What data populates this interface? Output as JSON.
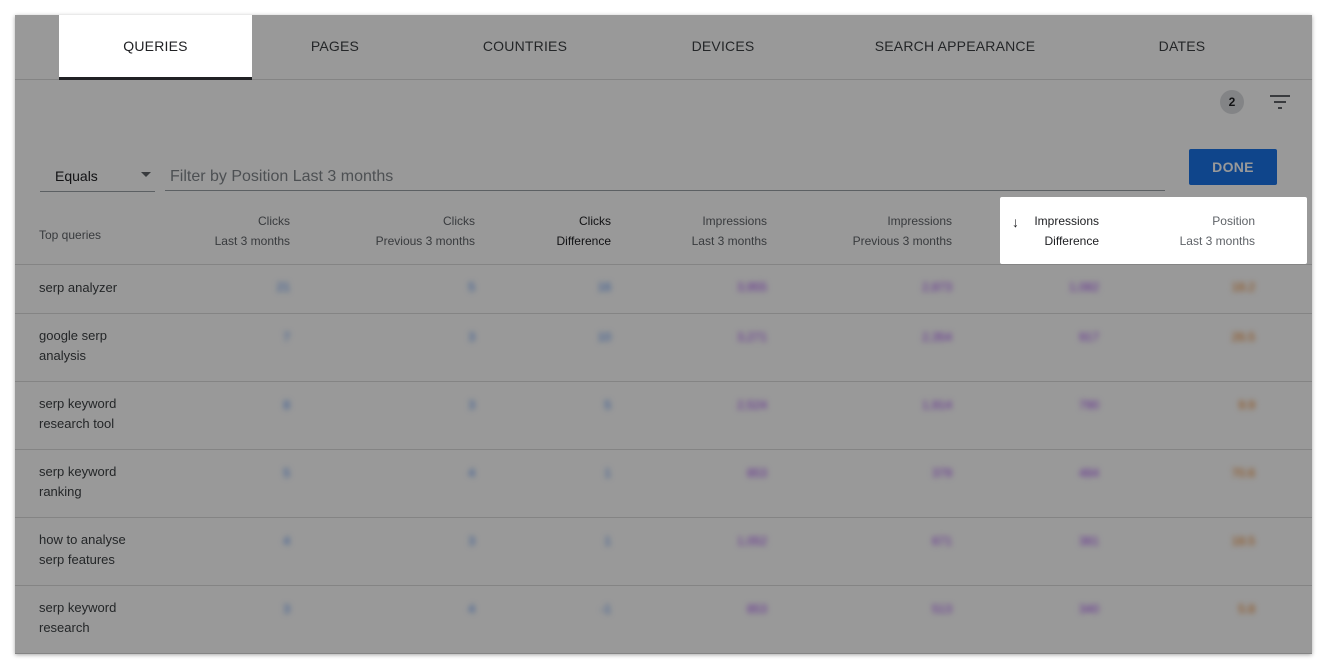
{
  "tabs": [
    {
      "label": "QUERIES",
      "active": true
    },
    {
      "label": "PAGES",
      "active": false
    },
    {
      "label": "COUNTRIES",
      "active": false
    },
    {
      "label": "DEVICES",
      "active": false
    },
    {
      "label": "SEARCH APPEARANCE",
      "active": false
    },
    {
      "label": "DATES",
      "active": false
    }
  ],
  "filters": {
    "count": "2",
    "icon": "filter-icon"
  },
  "filter_row": {
    "operator": "Equals",
    "placeholder": "Filter by Position Last 3 months",
    "done_label": "DONE"
  },
  "table": {
    "headers": {
      "query": "Top queries",
      "clicks_last": {
        "line1": "Clicks",
        "line2": "Last 3 months"
      },
      "clicks_prev": {
        "line1": "Clicks",
        "line2": "Previous 3 months"
      },
      "clicks_diff": {
        "line1": "Clicks",
        "line2": "Difference"
      },
      "impr_last": {
        "line1": "Impressions",
        "line2": "Last 3 months"
      },
      "impr_prev": {
        "line1": "Impressions",
        "line2": "Previous 3 months"
      },
      "impr_diff": {
        "line1": "Impressions",
        "line2": "Difference"
      },
      "position_last": {
        "line1": "Position",
        "line2": "Last 3 months"
      }
    },
    "rows": [
      {
        "query_line1": "serp analyzer",
        "query_line2": "",
        "v": [
          "21",
          "5",
          "16",
          "3,955",
          "2,873",
          "1,082",
          "18.2"
        ]
      },
      {
        "query_line1": "google serp",
        "query_line2": "analysis",
        "v": [
          "7",
          "3",
          "10",
          "3,271",
          "2,354",
          "917",
          "26.5"
        ]
      },
      {
        "query_line1": "serp keyword",
        "query_line2": "research tool",
        "v": [
          "8",
          "3",
          "5",
          "2,524",
          "1,914",
          "790",
          "9.9"
        ]
      },
      {
        "query_line1": "serp keyword",
        "query_line2": "ranking",
        "v": [
          "5",
          "4",
          "1",
          "853",
          "379",
          "484",
          "70.6"
        ]
      },
      {
        "query_line1": "how to analyse",
        "query_line2": "serp features",
        "v": [
          "4",
          "3",
          "1",
          "1,052",
          "671",
          "381",
          "18.5"
        ]
      },
      {
        "query_line1": "serp keyword",
        "query_line2": "research",
        "v": [
          "3",
          "4",
          "-1",
          "853",
          "513",
          "340",
          "5.8"
        ]
      }
    ]
  },
  "colors": {
    "done": "#1a73e8",
    "clicks": "#4285f4",
    "impressions": "#a142f4",
    "position": "#e8710a"
  }
}
